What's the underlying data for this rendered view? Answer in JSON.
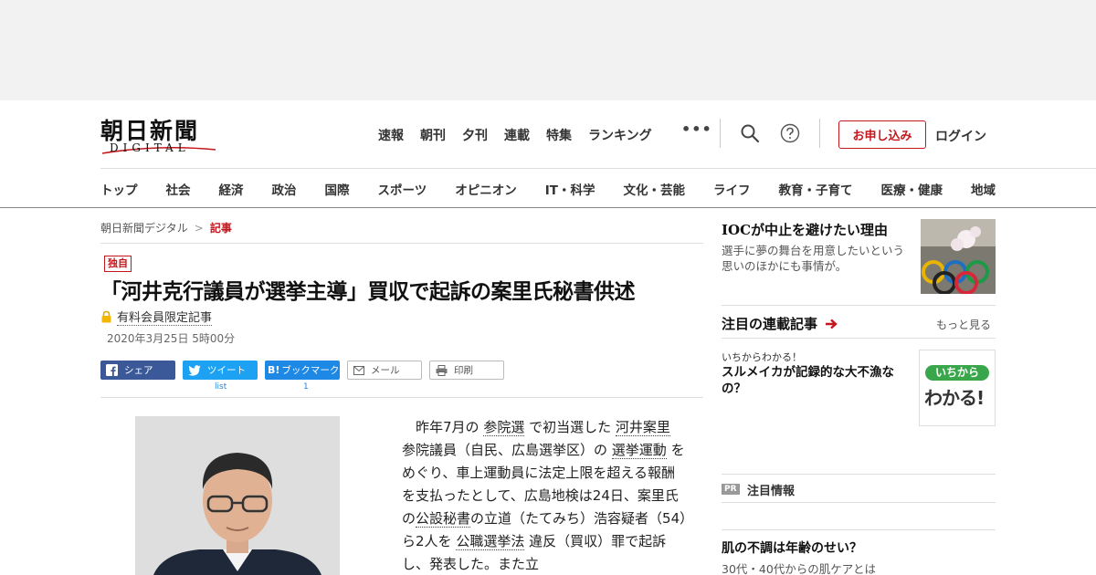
{
  "header": {
    "logo_kanji": "朝日新聞",
    "logo_sub": "DIGITAL",
    "main_nav": [
      "速報",
      "朝刊",
      "夕刊",
      "連載",
      "特集",
      "ランキング"
    ],
    "more": "•••",
    "subscribe": "お申し込み",
    "login": "ログイン"
  },
  "category_nav": [
    "トップ",
    "社会",
    "経済",
    "政治",
    "国際",
    "スポーツ",
    "オピニオン",
    "IT・科学",
    "文化・芸能",
    "ライフ",
    "教育・子育て",
    "医療・健康",
    "地域"
  ],
  "breadcrumb": {
    "home": "朝日新聞デジタル",
    "separator": ">",
    "current": "記事"
  },
  "article": {
    "badge": "独自",
    "headline": "「河井克行議員が選挙主導」買収で起訴の案里氏秘書供述",
    "paid_label": "有料会員限定記事",
    "date": "2020年3月25日 5時00分",
    "share": {
      "facebook": "シェア",
      "twitter": "ツイート",
      "twitter_count": "list",
      "hatena": "ブックマーク",
      "hatena_count": "1",
      "mail": "メール",
      "print": "印刷"
    },
    "body": {
      "p1": "昨年7月の",
      "l1": "参院選",
      "p2": "で初当選した",
      "l2": "河井案里",
      "p3": "参院議員（自民、広島選挙区）の",
      "l3": "選挙運動",
      "p4": "をめぐり、車上運動員に法定上限を超える報酬を支払ったとして、広島地検は24日、案里氏の",
      "l4": "公設秘書",
      "p5": "の立道（たてみち）浩容疑者（54）ら2人を",
      "l5": "公職選挙法",
      "p6": "違反（買収）罪で起訴し、発表した。また立"
    }
  },
  "sidebar": {
    "feature_title": "IOCが中止を避けたい理由",
    "feature_desc": "選手に夢の舞台を用意したいという思いのほかにも事情が。",
    "series_heading": "注目の連載記事",
    "series_more": "もっと見る",
    "series_kicker": "いちからわかる！",
    "series_title": "スルメイカが記録的な大不漁なの？",
    "series_badge_top": "いちから",
    "series_badge_bottom": "わかる!",
    "pr_tag": "PR",
    "pr_heading": "注目情報",
    "promo_title": "肌の不調は年齢のせい？",
    "promo_desc": "30代・40代からの肌ケアとは"
  },
  "colors": {
    "accent_red": "#c4161c",
    "facebook": "#3b5998",
    "twitter": "#1da1f2",
    "hatena": "#1e88e5"
  },
  "icons": [
    "search-icon",
    "help-icon",
    "lock-icon",
    "facebook-icon",
    "twitter-icon",
    "hatena-icon",
    "mail-icon",
    "print-icon",
    "arrow-right-icon"
  ]
}
